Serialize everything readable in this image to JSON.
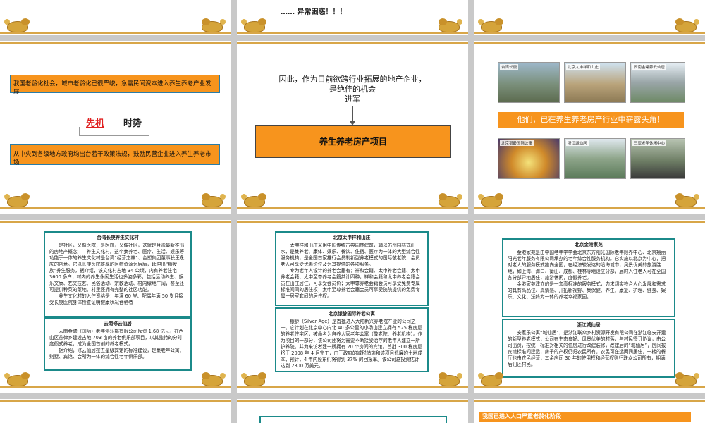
{
  "s1": {
    "text": "…… 异常困惑！！！"
  },
  "s3": {
    "box_top": "我国老龄化社会，城市老龄化已很严峻，急需民间资本进入养生养老产业发展",
    "opportunity": "先机",
    "trend": "时势",
    "box_bottom": "从中央到各级地方政府均出台若干政策法规，鼓励民营企业进入养生养老市场"
  },
  "s4": {
    "line1": "因此，作为目前欲跨行业拓展的地产企业，",
    "line2": "是绝佳的机会",
    "line3": "进军",
    "project": "养生养老房产项目"
  },
  "s5": {
    "banner": "他们，已在养生养老房产行业中崭露头角！",
    "photos": [
      "台湾长庚",
      "北京太申祥和山庄",
      "云南金曦养云仙居",
      "北京银龄国际公寓",
      "浙江城仙居",
      "三亚老年休闲中心"
    ]
  },
  "s6": {
    "box1_title": "台湾长庚养生文化村",
    "box1_p1": "是社区，又像医院；是医院，又像社区，这就是台湾最新推出的房地产概念——养生文化村。这个集养老、医疗、生活、娱乐等功能于一体的养生文化村是台湾“经营之神”、台塑集团董事长王永庆的创意。它以长庚医院雄厚的医疗资源为后盾，延伸出“银发族”养生服务，据介绍，该文化村占地 34 公顷，内有养老住宅 3600 多户，村内的养生休闲生活也多姿多彩，包括运动养生、娱乐文康、艺文技艺、民俗活动、宗教活动、村内绿地广阔，甚至还可提供种菜的菜地。村里还拥有完整的社区功能。",
    "box1_p2": "养生文化村的入住资格是：年满 60 岁、配偶年满 50 岁且接受长庚医院身体检查证明健康状况合格者",
    "box2_title": "云南修云仙居",
    "box2_p1": "云南金曦（国际）老年俱乐部有限公司斥资 1.68 亿元，在西山区谷律乡建设占地 703 亩的养老俱乐部项目，以其独特的分时度假式养老，成为全国首创的养老模式。",
    "box2_p2": "据介绍，修云仙居按五星级宾馆的标准建设，是集老年公寓、别墅、宾馆、会所为一体的综合性老年俱乐部。"
  },
  "s7": {
    "box1_title": "北京太申祥和山庄",
    "box1_p1": "太申祥和山庄采用中国传统古典园林建筑，辅以苏州园林式山水，是集养老、康体、娱乐、餐饮、住宿、医疗为一体的大型综合性服务机构，是全国首家推行会员制新型养老模式的国际敬老院，会员老人可享受优惠价位及为其提供的各项服务。",
    "box1_p2": "专为老年人设计的养老会籍有：祥和会籍、太申养老会籍、太申养老会籍、太申至尊养老会籍共计四种，祥和会籍和太申养老会籍会员在山庄居住，可享受会员价；太申尊养老会籍会员可享受免费专属标准间同的居住权；太申至尊养老会籍会员可享受院院提供的免费专属一居室套间的居住权。",
    "box2_title": "北京银龄国际养老公寓",
    "box2_p1": "银龄（Silver Age）是首批进入大陆新兴养老院产业的公司之一，它计划在北京中心向北 40 多公里的小汤山建立拥有 525 栋房屋的养老住宅区，被命名为自养人家老年公寓（敬老院、养老机构）。作为项目的一部分，该公司还将为需要不断接受治疗的老年人建立一所护养院。并为来访者建一所拥有 20 个房间的宾馆。首批 300 栋房屋将于 2008 年 4 月完工，由于政府的减税措施和该项目低廉的土地成本，预计，4 年内股东们将得到 37% 的回报率。该公司总投资估计达到 2300 万美元。"
  },
  "s8": {
    "box1_title": "北京金港家苑",
    "box1_p1": "金港家苑是由中国老年学学会北京东方阳光国际老年顾养中心、北京翔丽阳光老年服务有限公司承办的老年综合性服务机构。它实施以北京为中心，把对老人的服务模式推向全国，在经济较发达的沿海城市，风景优美的旅游胜地，如上海、海口、衡山、成都、桂林等地设立分部，届时入住老人可在全国各分部异地居住，旅游休闲，度假养老。",
    "box1_p2": "金港家苑建立的是一套高标准的服务模式，力求切实符合人心发展和需求的具有高品位、真情感、开拓新视野、集保健、养生、康复、护理、健身、娱乐、文化、送终为一体的养老幸福家园。",
    "box2_title": "浙江城仙居",
    "box2_p1": "安家乐公寓“城仙居”，是浙江联众乡村资源开发有限公司在浙江临安开建的新型养老模式，公司在生态良好、风景优美的村落，与村民签订协议，由公司出资，按统一标准对相关的住房进行改建装修，改建后的“城仙居”，房间按宾馆标准间建造，房子的产权仍归农民所有，农民可在选两间居住，一楼的餐厅也由农民经营，其余房间 30 年的使用权和经营权则归联众公司所有，期满后归还村民。"
  },
  "s11": {
    "banner": "我国已进入人口严重老龄化阶段"
  }
}
